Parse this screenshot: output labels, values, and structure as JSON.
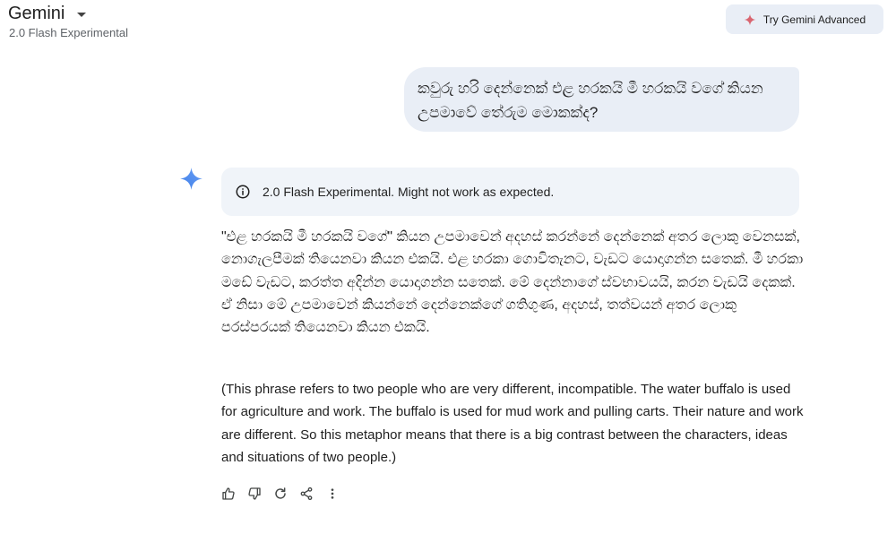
{
  "header": {
    "app_name": "Gemini",
    "model_name": "2.0 Flash Experimental",
    "upgrade_label": "Try Gemini Advanced"
  },
  "conversation": {
    "user_message": "කවුරු හරි දෙන්නෙක් එළ හරකයි මී හරකයි වගේ කියන උපමාවේ තේරුම මොකක්ද?",
    "notice": "2.0 Flash Experimental. Might not work as expected.",
    "response_sinhala": "\"එළ හරකයි මී හරකයි වගේ\" කියන උපමාවෙන් අදහස් කරන්නේ දෙන්නෙක් අතර ලොකු වෙනසක්, නොගැලපීමක් තියෙනවා කියන එකයි. එළ හරකා ගොවිතැනට, වැඩට යොදාගන්න සතෙක්. මී හරකා මඩේ වැඩට, කරත්ත අදින්න යොදාගන්න සතෙක්. මේ දෙන්නාගේ ස්වභාවයයි, කරන වැඩයි දෙකක්. ඒ නිසා මේ උපමාවෙන් කියන්නේ දෙන්නෙක්ගේ ගතිගුණ, අදහස්, තත්වයන් අතර ලොකු පරස්පරයක් තියෙනවා කියන එකයි.",
    "response_english": "(This phrase refers to two people who are very different, incompatible. The water buffalo is used for agriculture and work. The buffalo is used for mud work and pulling carts. Their nature and work are different. So this metaphor means that there is a big contrast between the characters, ideas and situations of two people.)"
  },
  "actions": [
    {
      "icon": "thumbs-up-icon"
    },
    {
      "icon": "thumbs-down-icon"
    },
    {
      "icon": "regenerate-icon"
    },
    {
      "icon": "share-icon"
    },
    {
      "icon": "more-vertical-icon"
    }
  ],
  "colors": {
    "spark_blue": "#4f8df5",
    "upgrade_spark": "#d96570",
    "bubble_bg": "#e9eef6",
    "notice_bg": "#f0f4f9"
  }
}
